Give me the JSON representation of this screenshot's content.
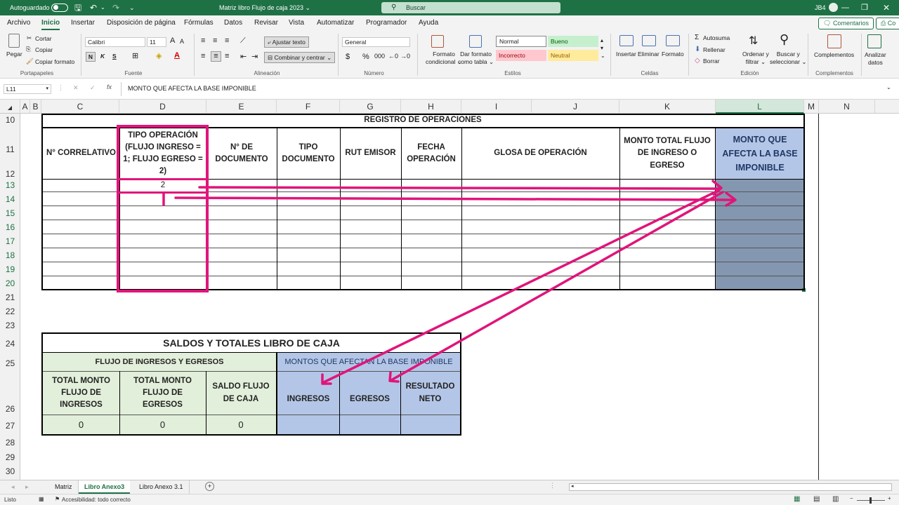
{
  "titlebar": {
    "autosave": "Autoguardado",
    "doc_title": "Matriz libro Flujo de caja 2023 ⌄",
    "search": "Buscar",
    "user": "JB4"
  },
  "menu": {
    "tabs": [
      "Archivo",
      "Inicio",
      "Insertar",
      "Disposición de página",
      "Fórmulas",
      "Datos",
      "Revisar",
      "Vista",
      "Automatizar",
      "Programador",
      "Ayuda"
    ],
    "comments": "Comentarios",
    "share": "Co"
  },
  "ribbon": {
    "paste": "Pegar",
    "cut": "Cortar",
    "copy": "Copiar",
    "format_painter": "Copiar formato",
    "clipboard_group": "Portapapeles",
    "font_name": "Calibri",
    "font_size": "11",
    "font_group": "Fuente",
    "wrap_text": "Ajustar texto",
    "merge_center": "Combinar y centrar",
    "alignment_group": "Alineación",
    "number_format": "General",
    "number_group": "Número",
    "cond_format": [
      "Formato",
      "condicional"
    ],
    "table_format": [
      "Dar formato",
      "como tabla"
    ],
    "style_normal": "Normal",
    "style_good": "Bueno",
    "style_bad": "Incorrecto",
    "style_neutral": "Neutral",
    "styles_group": "Estilos",
    "insert": "Insertar",
    "delete": "Eliminar",
    "format": "Formato",
    "cells_group": "Celdas",
    "autosum": "Autosuma",
    "fill": "Rellenar",
    "clear": "Borrar",
    "sort_filter": [
      "Ordenar y",
      "filtrar"
    ],
    "find_select": [
      "Buscar y",
      "seleccionar"
    ],
    "editing_group": "Edición",
    "addins": "Complementos",
    "addins_group": "Complementos",
    "analyze": [
      "Analizar",
      "datos"
    ]
  },
  "formula_bar": {
    "name_box": "L11",
    "fx": "fx",
    "formula": "MONTO QUE AFECTA LA BASE IMPONIBLE"
  },
  "columns": [
    "A",
    "B",
    "C",
    "D",
    "E",
    "F",
    "G",
    "H",
    "I",
    "J",
    "K",
    "L",
    "M",
    "N"
  ],
  "rows": [
    "10",
    "11",
    "12",
    "13",
    "14",
    "15",
    "16",
    "17",
    "18",
    "19",
    "20",
    "21",
    "22",
    "23",
    "24",
    "25",
    "26",
    "27",
    "28",
    "29",
    "30"
  ],
  "registro": {
    "title": "REGISTRO DE OPERACIONES",
    "headers": [
      "N° CORRELATIVO",
      "TIPO OPERACIÓN (FLUJO INGRESO = 1; FLUJO EGRESO = 2)",
      "N° DE DOCUMENTO",
      "TIPO DOCUMENTO",
      "RUT EMISOR",
      "FECHA OPERACIÓN",
      "GLOSA DE OPERACIÓN",
      "MONTO TOTAL FLUJO DE INGRESO O EGRESO",
      "MONTO QUE AFECTA LA BASE IMPONIBLE"
    ],
    "d13_value": "2"
  },
  "saldos": {
    "title": "SALDOS Y TOTALES LIBRO DE CAJA",
    "flujo_header": "FLUJO DE INGRESOS Y EGRESOS",
    "montos_header": "MONTOS QUE AFECTAN LA BASE IMPONIBLE",
    "col_headers": [
      "TOTAL MONTO FLUJO DE INGRESOS",
      "TOTAL MONTO FLUJO DE EGRESOS",
      "SALDO FLUJO DE CAJA",
      "INGRESOS",
      "EGRESOS",
      "RESULTADO NETO"
    ],
    "values": [
      "0",
      "0",
      "0"
    ]
  },
  "sheets": {
    "tabs": [
      "Matriz",
      "Libro Anexo3",
      "Libro Anexo 3.1"
    ],
    "active": "Libro Anexo3"
  },
  "status": {
    "ready": "Listo",
    "accessibility": "Accesibilidad: todo correcto"
  },
  "colors": {
    "excel_green": "#1e7145",
    "header_blue": "#b4c6e7",
    "header_green": "#e2efda",
    "selected_fill": "#8497b0",
    "annotation_magenta": "#e0157a"
  }
}
